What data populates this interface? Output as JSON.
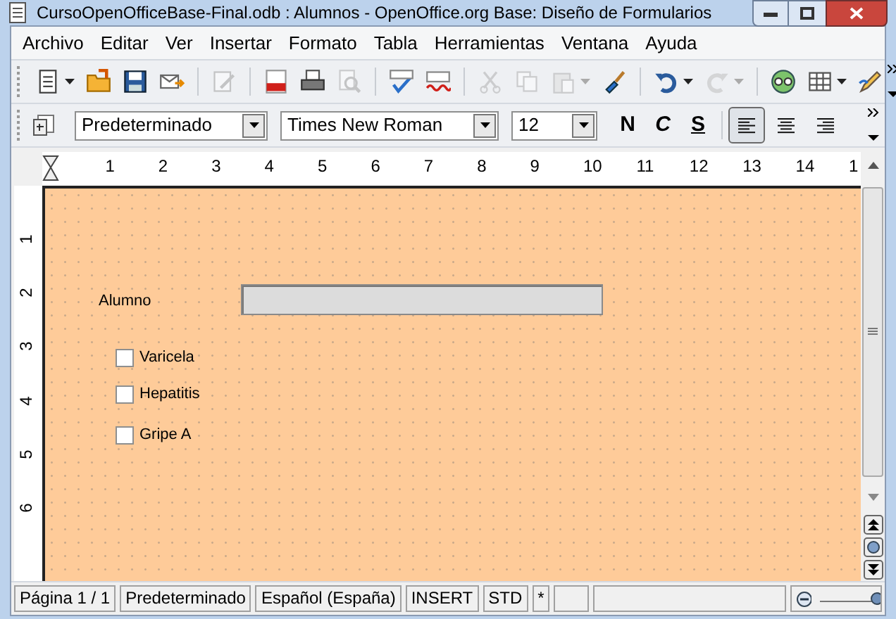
{
  "window": {
    "title": "CursoOpenOfficeBase-Final.odb : Alumnos - OpenOffice.org Base: Diseño de Formularios"
  },
  "menu": [
    {
      "label": "Archivo"
    },
    {
      "label": "Editar"
    },
    {
      "label": "Ver"
    },
    {
      "label": "Insertar"
    },
    {
      "label": "Formato"
    },
    {
      "label": "Tabla"
    },
    {
      "label": "Herramientas"
    },
    {
      "label": "Ventana"
    },
    {
      "label": "Ayuda"
    }
  ],
  "standard_toolbar": [
    {
      "kind": "new",
      "disabled": false,
      "dropdown": true
    },
    {
      "kind": "open",
      "disabled": false,
      "dropdown": false
    },
    {
      "kind": "save",
      "disabled": false,
      "dropdown": false
    },
    {
      "kind": "mail",
      "disabled": false,
      "dropdown": false
    },
    {
      "kind": "separator"
    },
    {
      "kind": "edit",
      "disabled": true,
      "dropdown": false
    },
    {
      "kind": "separator"
    },
    {
      "kind": "pdf",
      "disabled": false,
      "dropdown": false
    },
    {
      "kind": "print",
      "disabled": false,
      "dropdown": false
    },
    {
      "kind": "preview",
      "disabled": true,
      "dropdown": false
    },
    {
      "kind": "separator"
    },
    {
      "kind": "spell",
      "disabled": false,
      "dropdown": false
    },
    {
      "kind": "autospell",
      "disabled": false,
      "dropdown": false
    },
    {
      "kind": "separator"
    },
    {
      "kind": "cut",
      "disabled": true,
      "dropdown": false
    },
    {
      "kind": "copy",
      "disabled": true,
      "dropdown": false
    },
    {
      "kind": "paste",
      "disabled": true,
      "dropdown": true
    },
    {
      "kind": "brush",
      "disabled": false,
      "dropdown": false
    },
    {
      "kind": "separator"
    },
    {
      "kind": "undo",
      "disabled": false,
      "dropdown": true
    },
    {
      "kind": "redo",
      "disabled": true,
      "dropdown": true
    },
    {
      "kind": "separator"
    },
    {
      "kind": "navigator",
      "disabled": false,
      "dropdown": false
    },
    {
      "kind": "table",
      "disabled": false,
      "dropdown": true
    },
    {
      "kind": "draw",
      "disabled": false,
      "dropdown": false
    }
  ],
  "formatting_toolbar": {
    "style": "Predeterminado",
    "font": "Times New Roman",
    "size": "12",
    "buttons": [
      {
        "label": "N",
        "kind": "bold",
        "selected": false
      },
      {
        "label": "C",
        "kind": "italic",
        "selected": false
      },
      {
        "label": "S",
        "kind": "underline",
        "selected": false
      }
    ],
    "alignment": [
      {
        "kind": "left",
        "selected": true
      },
      {
        "kind": "center",
        "selected": false
      },
      {
        "kind": "right",
        "selected": false
      }
    ]
  },
  "ruler": {
    "horizontal": [
      "1",
      "2",
      "3",
      "4",
      "5",
      "6",
      "7",
      "8",
      "9",
      "10",
      "11",
      "12",
      "13",
      "14",
      "1"
    ],
    "vertical": [
      "1",
      "2",
      "3",
      "4",
      "5",
      "6"
    ]
  },
  "form": {
    "field_label": "Alumno",
    "checkboxes": [
      {
        "label": "Varicela",
        "checked": false
      },
      {
        "label": "Hepatitis",
        "checked": false
      },
      {
        "label": "Gripe A",
        "checked": false
      }
    ]
  },
  "status_bar": [
    "Página 1 / 1",
    "Predeterminado",
    "Español (España)",
    "INSERT",
    "STD",
    "*"
  ],
  "zoom_slider": {
    "level": 0.97
  }
}
